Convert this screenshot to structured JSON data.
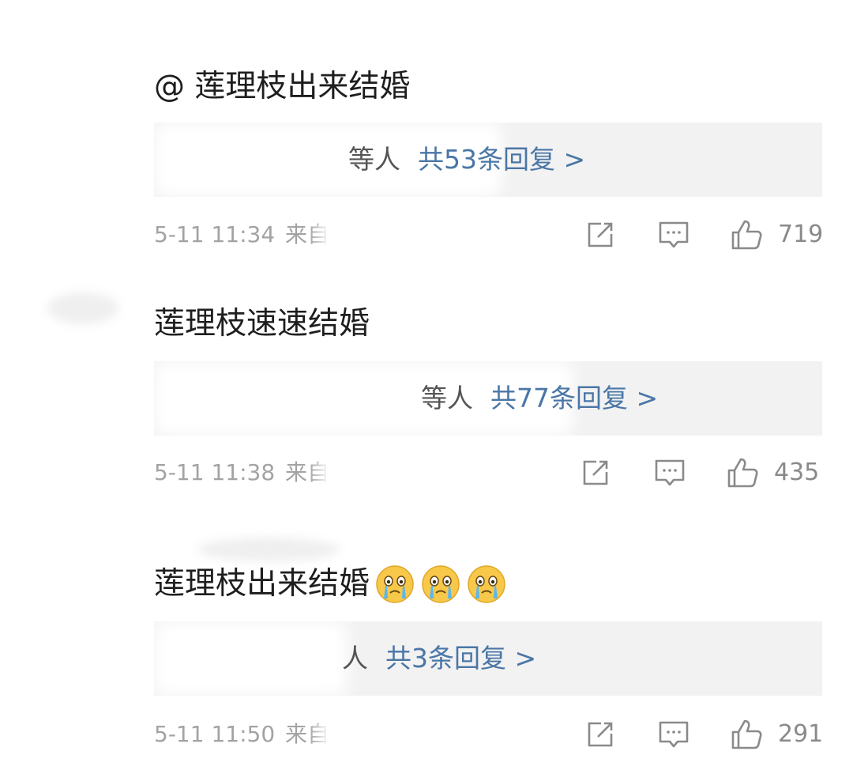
{
  "comments": [
    {
      "text": "@ 莲理枝出来结婚",
      "emojis": [],
      "reply_who": "等人",
      "reply_count": "共53条回复 >",
      "time": "5-11 11:34",
      "source": "来自",
      "likes": "719"
    },
    {
      "text": "莲理枝速速结婚",
      "emojis": [],
      "reply_who": "等人",
      "reply_count": "共77条回复 >",
      "time": "5-11 11:38",
      "source": "来自",
      "likes": "435"
    },
    {
      "text": "莲理枝出来结婚",
      "emojis": [
        "crying-face-emoji",
        "crying-face-emoji",
        "crying-face-emoji"
      ],
      "reply_who": "人",
      "reply_count": "共3条回复 >",
      "time": "5-11 11:50",
      "source": "来自",
      "likes": "291"
    }
  ],
  "icons": {
    "share": "share-icon",
    "comment": "comment-icon",
    "like": "thumbs-up-icon"
  },
  "colors": {
    "text": "#1e1e1e",
    "link": "#4a76a6",
    "meta": "#a3a3a3",
    "reply_bg": "#f2f2f2"
  }
}
